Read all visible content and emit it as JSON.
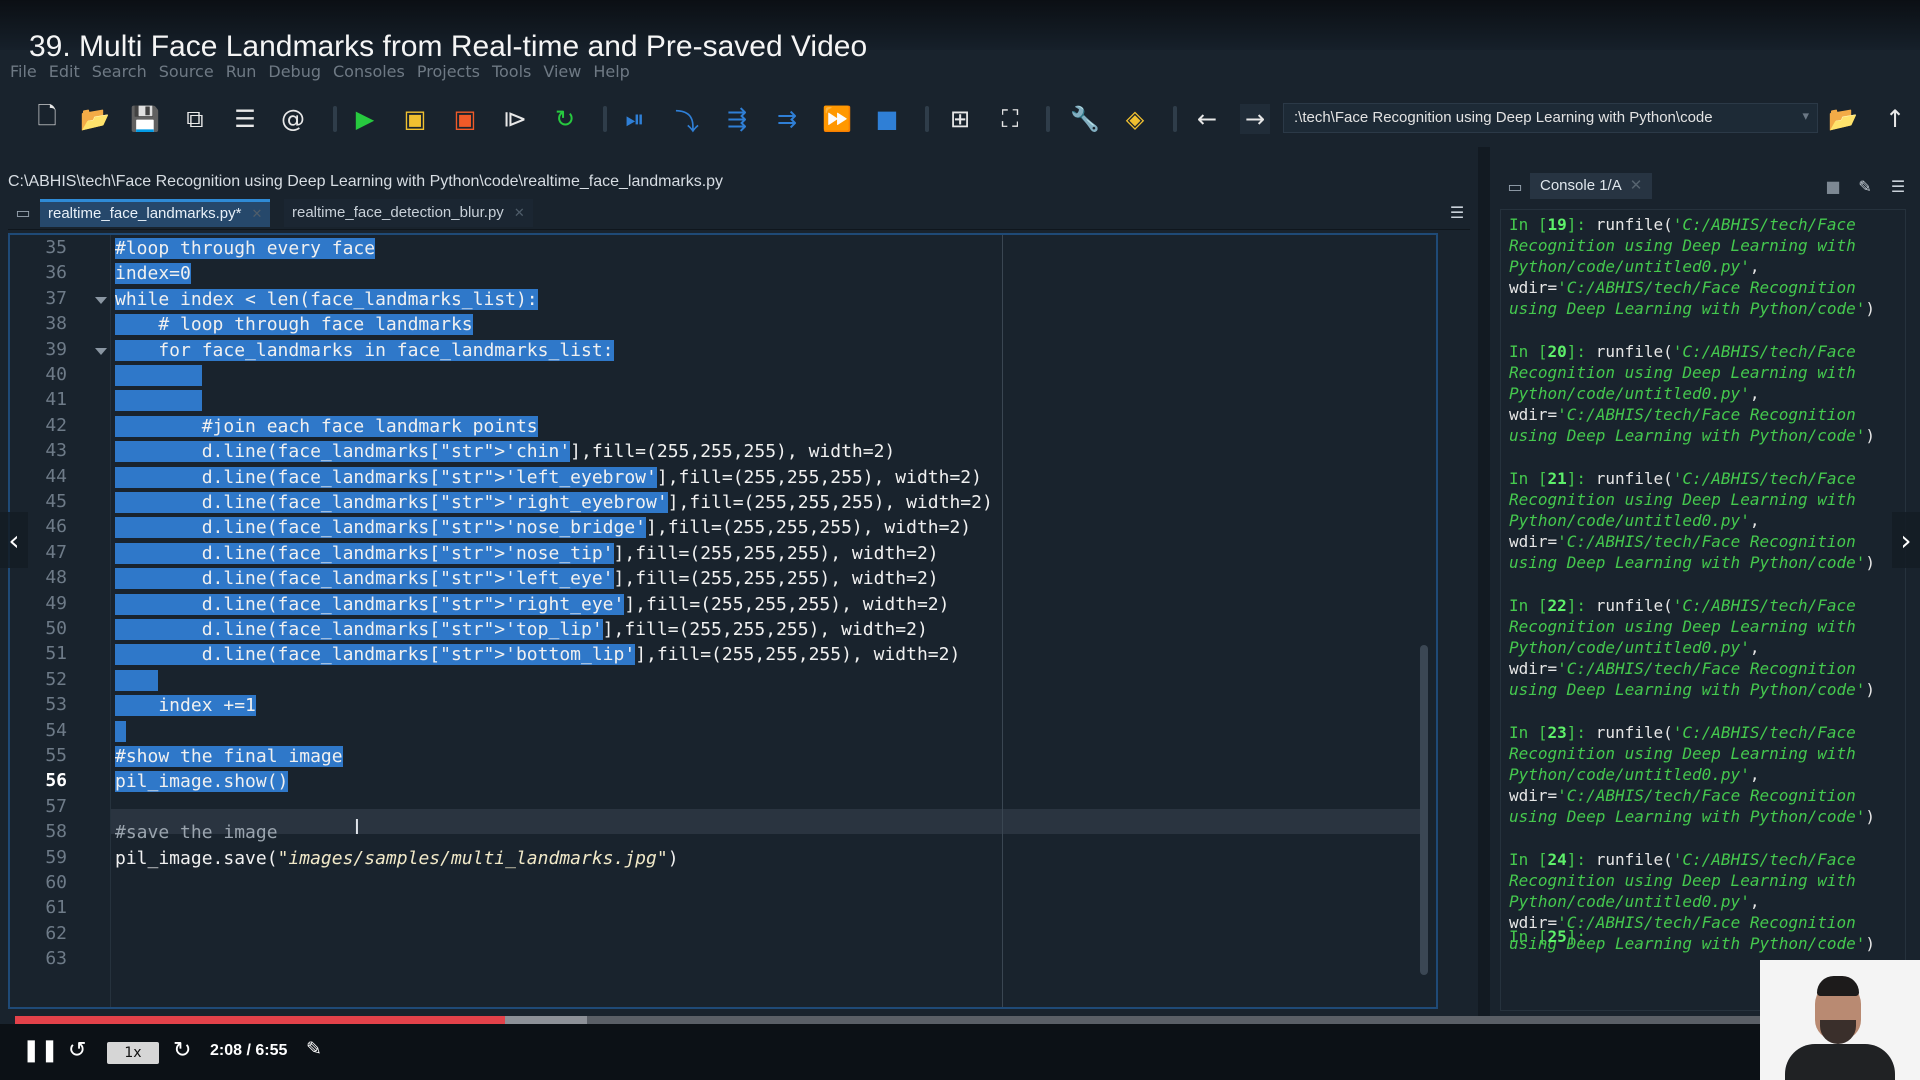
{
  "video": {
    "title": "39. Multi Face Landmarks from Real-time and Pre-saved Video"
  },
  "menubar": {
    "items": [
      "File",
      "Edit",
      "Search",
      "Source",
      "Run",
      "Debug",
      "Consoles",
      "Projects",
      "Tools",
      "View",
      "Help"
    ]
  },
  "toolbar": {
    "path": ":\\tech\\Face Recognition using Deep Learning with Python\\code",
    "icons": [
      "new-file-icon",
      "open-folder-icon",
      "save-icon",
      "save-all-icon",
      "outline-icon",
      "at-icon",
      "run-icon",
      "run-cell-icon",
      "run-cell-advance-icon",
      "run-selection-icon",
      "rerun-icon",
      "debug-icon",
      "step-icon",
      "step-into-icon",
      "step-return-icon",
      "continue-icon",
      "stop-icon",
      "maximize-pane-icon",
      "fullscreen-icon",
      "preferences-icon",
      "python-path-icon",
      "back-icon",
      "forward-icon",
      "browse-folder-icon",
      "parent-dir-icon"
    ]
  },
  "editor": {
    "file_path": "C:\\ABHIS\\tech\\Face Recognition using Deep Learning with Python\\code\\realtime_face_landmarks.py",
    "tabs": [
      {
        "label": "realtime_face_landmarks.py*",
        "active": true
      },
      {
        "label": "realtime_face_detection_blur.py",
        "active": false
      }
    ],
    "current_line": "56",
    "line_numbers": [
      "35",
      "36",
      "37",
      "38",
      "39",
      "40",
      "41",
      "42",
      "43",
      "44",
      "45",
      "46",
      "47",
      "48",
      "49",
      "50",
      "51",
      "52",
      "53",
      "54",
      "55",
      "56",
      "57",
      "58",
      "59",
      "60",
      "61",
      "62",
      "63"
    ],
    "lines": [
      "#loop through every face",
      "index=0",
      "while index < len(face_landmarks_list):",
      "    # loop through face landmarks",
      "    for face_landmarks in face_landmarks_list:",
      "        ",
      "        ",
      "        #join each face landmark points",
      "        d.line(face_landmarks['chin'],fill=(255,255,255), width=2)",
      "        d.line(face_landmarks['left_eyebrow'],fill=(255,255,255), width=2)",
      "        d.line(face_landmarks['right_eyebrow'],fill=(255,255,255), width=2)",
      "        d.line(face_landmarks['nose_bridge'],fill=(255,255,255), width=2)",
      "        d.line(face_landmarks['nose_tip'],fill=(255,255,255), width=2)",
      "        d.line(face_landmarks['left_eye'],fill=(255,255,255), width=2)",
      "        d.line(face_landmarks['right_eye'],fill=(255,255,255), width=2)",
      "        d.line(face_landmarks['top_lip'],fill=(255,255,255), width=2)",
      "        d.line(face_landmarks['bottom_lip'],fill=(255,255,255), width=2)",
      "    ",
      "    index +=1",
      "",
      "#show the final image",
      "pil_image.show()",
      "",
      "#save the image",
      "pil_image.save(\"images/samples/multi_landmarks.jpg\")",
      "",
      "",
      "",
      ""
    ],
    "selected_until_line": "56"
  },
  "console": {
    "tab_label": "Console 1/A",
    "entries": [
      {
        "prompt": "In [",
        "num": "19",
        "close": "]: ",
        "cmd": "runfile(",
        "arg": "'C:/ABHIS/tech/Face Recognition using Deep Learning with Python/code/untitled0.py'",
        "mid": ", wdir=",
        "arg2": "'C:/ABHIS/tech/Face Recognition using Deep Learning with Python/code'",
        "end": ")"
      },
      {
        "prompt": "In [",
        "num": "20",
        "close": "]: ",
        "cmd": "runfile(",
        "arg": "'C:/ABHIS/tech/Face Recognition using Deep Learning with Python/code/untitled0.py'",
        "mid": ", wdir=",
        "arg2": "'C:/ABHIS/tech/Face Recognition using Deep Learning with Python/code'",
        "end": ")"
      },
      {
        "prompt": "In [",
        "num": "21",
        "close": "]: ",
        "cmd": "runfile(",
        "arg": "'C:/ABHIS/tech/Face Recognition using Deep Learning with Python/code/untitled0.py'",
        "mid": ", wdir=",
        "arg2": "'C:/ABHIS/tech/Face Recognition using Deep Learning with Python/code'",
        "end": ")"
      },
      {
        "prompt": "In [",
        "num": "22",
        "close": "]: ",
        "cmd": "runfile(",
        "arg": "'C:/ABHIS/tech/Face Recognition using Deep Learning with Python/code/untitled0.py'",
        "mid": ", wdir=",
        "arg2": "'C:/ABHIS/tech/Face Recognition using Deep Learning with Python/code'",
        "end": ")"
      },
      {
        "prompt": "In [",
        "num": "23",
        "close": "]: ",
        "cmd": "runfile(",
        "arg": "'C:/ABHIS/tech/Face Recognition using Deep Learning with Python/code/untitled0.py'",
        "mid": ", wdir=",
        "arg2": "'C:/ABHIS/tech/Face Recognition using Deep Learning with Python/code'",
        "end": ")"
      },
      {
        "prompt": "In [",
        "num": "24",
        "close": "]: ",
        "cmd": "runfile(",
        "arg": "'C:/ABHIS/tech/Face Recognition using Deep Learning with Python/code/untitled0.py'",
        "mid": ", wdir=",
        "arg2": "'C:/ABHIS/tech/Face Recognition using Deep Learning with Python/code'",
        "end": ")"
      }
    ],
    "pending_prompt": "In [",
    "pending_num": "25",
    "pending_close": "]:"
  },
  "player": {
    "speed": "1x",
    "time": "2:08 / 6:55",
    "played_fraction": 0.257,
    "buffered_fraction": 0.3,
    "colors": {
      "played": "#e3424a",
      "buffered": "#8d9198",
      "track": "#5a5f66"
    }
  }
}
